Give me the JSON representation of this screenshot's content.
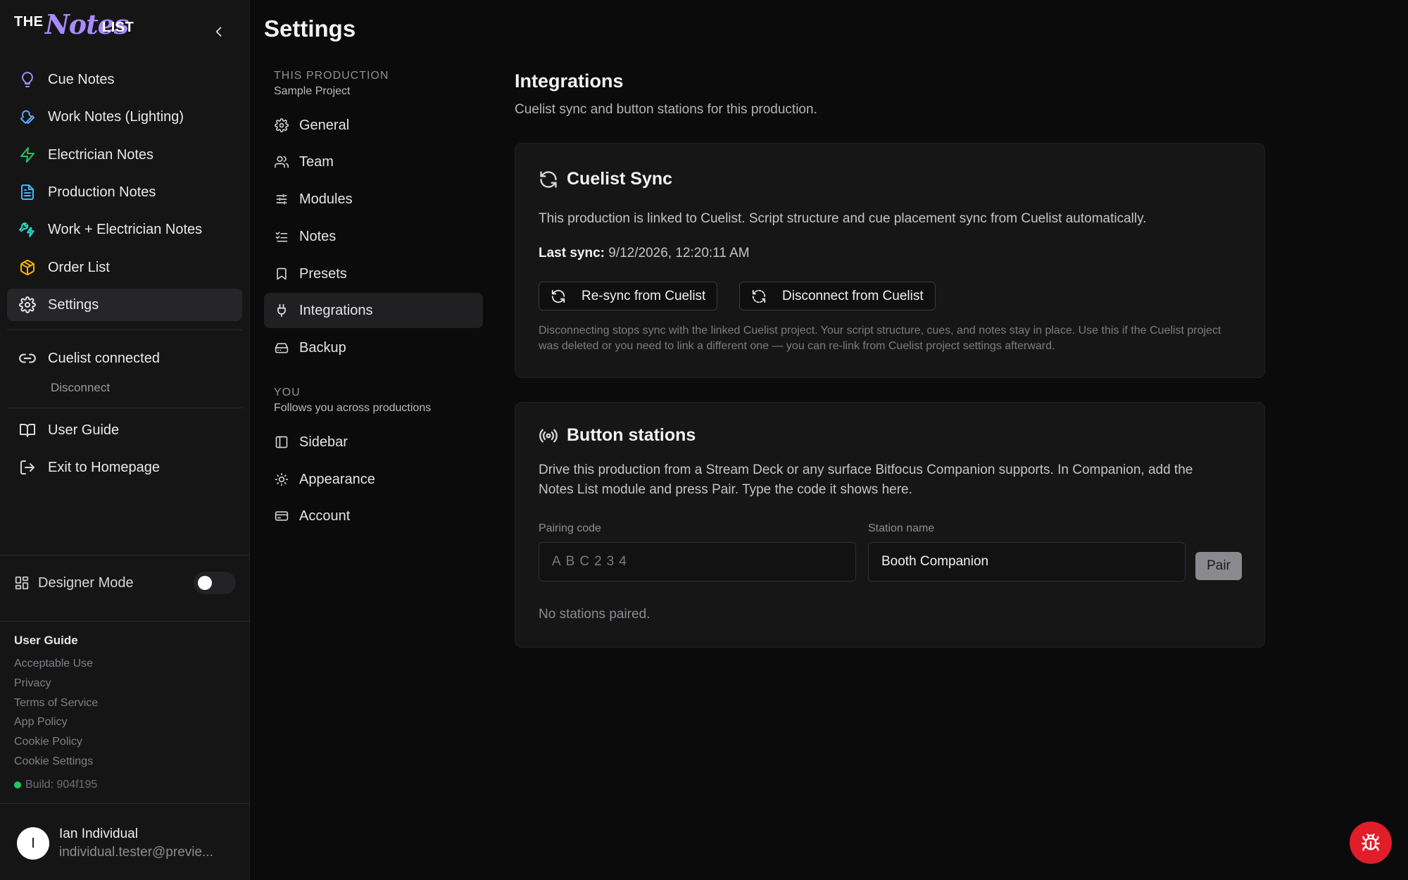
{
  "logo": {
    "the": "THE",
    "notes": "Notes",
    "list": "LIST"
  },
  "sidebar": {
    "nav": [
      {
        "label": "Cue Notes",
        "icon": "lightbulb-icon",
        "color": "#a78bfa"
      },
      {
        "label": "Work Notes (Lighting)",
        "icon": "wrench-icon",
        "color": "#60a5fa"
      },
      {
        "label": "Electrician Notes",
        "icon": "zap-icon",
        "color": "#22c55e"
      },
      {
        "label": "Production Notes",
        "icon": "file-text-icon",
        "color": "#38bdf8"
      },
      {
        "label": "Work + Electrician Notes",
        "icon": "wrench-zap-icon",
        "color": "#2dd4bf"
      },
      {
        "label": "Order List",
        "icon": "package-icon",
        "color": "#f5b400"
      },
      {
        "label": "Settings",
        "icon": "gear-icon",
        "color": "#e5e5e7",
        "active": true
      }
    ],
    "cuelist_status": "Cuelist connected",
    "disconnect": "Disconnect",
    "user_guide": "User Guide",
    "exit": "Exit to Homepage",
    "designer_mode": {
      "label": "Designer Mode",
      "on": false
    },
    "footer": {
      "heading": "User Guide",
      "links": [
        "Acceptable Use",
        "Privacy",
        "Terms of Service",
        "App Policy",
        "Cookie Policy",
        "Cookie Settings"
      ],
      "build": "Build: 904f195"
    },
    "user": {
      "initial": "I",
      "name": "Ian Individual",
      "email": "individual.tester@previe..."
    }
  },
  "settings": {
    "title": "Settings",
    "production_caption": "THIS PRODUCTION",
    "production_name": "Sample Project",
    "production_items": [
      {
        "label": "General",
        "icon": "gear-icon"
      },
      {
        "label": "Team",
        "icon": "users-icon"
      },
      {
        "label": "Modules",
        "icon": "sliders-icon"
      },
      {
        "label": "Notes",
        "icon": "list-checks-icon"
      },
      {
        "label": "Presets",
        "icon": "bookmark-icon"
      },
      {
        "label": "Integrations",
        "icon": "plug-icon",
        "active": true
      },
      {
        "label": "Backup",
        "icon": "hard-drive-icon"
      }
    ],
    "you_caption": "YOU",
    "you_sub": "Follows you across productions",
    "you_items": [
      {
        "label": "Sidebar",
        "icon": "panel-left-icon"
      },
      {
        "label": "Appearance",
        "icon": "sun-icon"
      },
      {
        "label": "Account",
        "icon": "credit-card-icon"
      }
    ]
  },
  "content": {
    "title": "Integrations",
    "subtitle": "Cuelist sync and button stations for this production.",
    "cuelist": {
      "title": "Cuelist Sync",
      "description": "This production is linked to Cuelist. Script structure and cue placement sync from Cuelist automatically.",
      "last_sync_label": "Last sync:",
      "last_sync_value": "9/12/2026, 12:20:11 AM",
      "resync_label": "Re-sync from Cuelist",
      "disconnect_label": "Disconnect from Cuelist",
      "fine_print": "Disconnecting stops sync with the linked Cuelist project. Your script structure, cues, and notes stay in place. Use this if the Cuelist project was deleted or you need to link a different one — you can re-link from Cuelist project settings afterward."
    },
    "stations": {
      "title": "Button stations",
      "description_1": "Drive this production from a Stream Deck or any surface Bitfocus Companion supports. In Companion, add the",
      "description_2": "Notes List module and press Pair. Type the code it shows here.",
      "pairing_label": "Pairing code",
      "pairing_placeholder": "ABC234",
      "station_label": "Station name",
      "station_value": "Booth Companion",
      "pair_label": "Pair",
      "empty": "No stations paired."
    }
  }
}
